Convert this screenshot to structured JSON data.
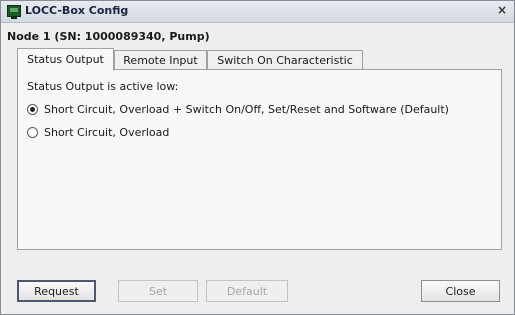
{
  "window": {
    "title": "LOCC-Box Config",
    "close_symbol": "×",
    "icon": "app-monitor-icon"
  },
  "node_label": "Node 1 (SN: 1000089340, Pump)",
  "tabs": [
    {
      "label": "Status Output",
      "active": true
    },
    {
      "label": "Remote Input",
      "active": false
    },
    {
      "label": "Switch On Characteristic",
      "active": false
    }
  ],
  "panel": {
    "description": "Status Output is active low:",
    "options": [
      {
        "label": "Short Circuit, Overload + Switch On/Off, Set/Reset and Software (Default)",
        "selected": true
      },
      {
        "label": "Short Circuit, Overload",
        "selected": false
      }
    ]
  },
  "buttons": {
    "request": {
      "label": "Request",
      "enabled": true
    },
    "set": {
      "label": "Set",
      "enabled": false
    },
    "default": {
      "label": "Default",
      "enabled": false
    },
    "close": {
      "label": "Close",
      "enabled": true
    }
  }
}
